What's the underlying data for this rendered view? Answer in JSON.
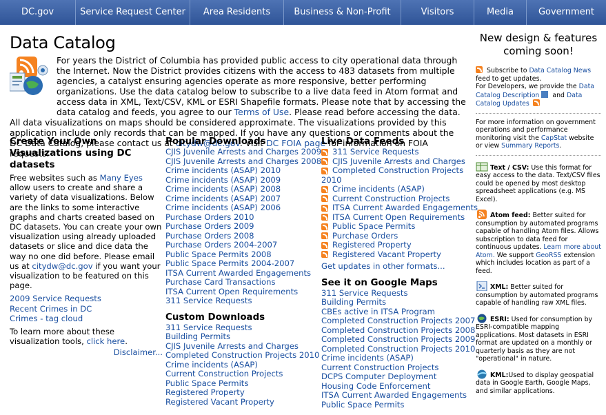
{
  "nav": [
    "DC.gov",
    "Service Request Center",
    "Area Residents",
    "Business & Non-Profit",
    "Visitors",
    "Media",
    "Government"
  ],
  "title": "Data Catalog",
  "intro": {
    "t1": "For years the District of Columbia has provided public access to city operational data through the Internet. Now the District provides citizens with the access to 483 datasets from multiple agencies, a catalyst ensuring agencies operate as more responsive, better performing organizations. Use the data catalog below to subscribe to a live data feed in Atom format and access data in XML, Text/CSV, KML or ESRI Shapefile formats. Please note that by accessing the data catalog and feeds, you agree to our ",
    "terms": "Terms of Use",
    "t2": ". Please read before accessing the data. All data visualizations on maps should be considered approximate. The visualizations provided by this application include only records that can be mapped. If you have any questions or comments about the DC Data Catalog, please contact us at ",
    "email": "citydw@dc.gov",
    "t3": ". Visit ",
    "foia": "DC FOIA page",
    "t4": " for information on FOIA requests."
  },
  "col1": {
    "heading": "Create Your Own Visualizations using DC datasets",
    "p1a": "Free websites such as ",
    "manyeyes": "Many Eyes",
    "p1b": " allow users to create and share a variety of data visualizations. Below are the links to some interactive graphs and charts created based on DC datasets. You can create your own visualization using already uploaded datasets or slice and dice data the way no one did before. Please email us at ",
    "email": "citydw@dc.gov",
    "p1c": " if you want your visualization to be featured on this page.",
    "links": [
      "2009 Service Requests",
      "Recent Crimes in DC",
      "Crimes - tag cloud"
    ],
    "p2a": "To learn more about these visualization tools, ",
    "clickhere": "click here",
    "p2b": ".",
    "disclaimer": "Disclaimer..."
  },
  "popular": {
    "heading": "Popular Downloads",
    "items": [
      "CJIS Juvenile Arrests and Charges 2009",
      "CJIS Juvenile Arrests and Charges 2008",
      "Crime incidents (ASAP) 2010",
      "Crime incidents (ASAP) 2009",
      "Crime incidents (ASAP) 2008",
      "Crime incidents (ASAP) 2007",
      "Crime incidents (ASAP) 2006",
      "Purchase Orders 2010",
      "Purchase Orders 2009",
      "Purchase Orders 2008",
      "Purchase Orders 2004-2007",
      "Public Space Permits 2008",
      "Public Space Permits 2004-2007",
      "ITSA Current Awarded Engagements",
      "Purchase Card Transactions",
      "ITSA Current Open Requirements",
      "311 Service Requests"
    ]
  },
  "custom": {
    "heading": "Custom Downloads",
    "items": [
      "311 Service Requests",
      "Building Permits",
      "CJIS Juvenile Arrests and Charges",
      "Completed Construction Projects 2010",
      "Crime incidents (ASAP)",
      "Current Construction Projects",
      "Public Space Permits",
      "Registered Property",
      "Registered Vacant Property"
    ]
  },
  "live": {
    "heading": "Live Data Feeds",
    "items": [
      "311 Service Requests",
      "CJIS Juvenile Arrests and Charges",
      "Completed Construction Projects",
      "Crime incidents (ASAP)",
      "Current Construction Projects",
      "ITSA Current Awarded Engagements",
      "ITSA Current Open Requirements",
      "Public Space Permits",
      "Purchase Orders",
      "Registered Property",
      "Registered Vacant Property"
    ],
    "wrap_tail": "2010",
    "more": "Get updates in other formats..."
  },
  "maps": {
    "heading": "See it on Google Maps",
    "items": [
      "311 Service Requests",
      "Building Permits",
      "CBEs active in ITSA Program",
      "Completed Construction Projects 2007",
      "Completed Construction Projects 2008",
      "Completed Construction Projects 2009",
      "Completed Construction Projects 2010",
      "Crime incidents (ASAP)",
      "Current Construction Projects",
      "DCPS Computer Deployment",
      "Housing Code Enforcement",
      "ITSA Current Awarded Engagements",
      "Public Space Permits"
    ]
  },
  "sidebar": {
    "new_head": "New design & features coming soon!",
    "sub1": "Subscribe to ",
    "news": "Data Catalog News",
    "sub2": " feed to get updates.",
    "dev1": "For Developers, we provide the ",
    "desc": "Data Catalog Description",
    "dev2": " and ",
    "updates": "Data Catalog Updates",
    "info1": "For more information on government operations and performance monitoring visit the ",
    "capstat": "CapStat",
    "info2": " website or view ",
    "summary": "Summary Reports",
    "info3": ".",
    "text_label": "Text / CSV:",
    "text_desc": " Use this format for easy access to the data. Text/CSV files could be opened by most desktop spreadsheet applications (e.g. MS Excel).",
    "atom_label": "Atom feed:",
    "atom_desc1": " Better suited for consumption by automated programs capable of handling Atom files. Allows subscription to data feed for continuous updates. ",
    "atom_link": "Learn more about Atom.",
    "atom_desc2": " We support ",
    "georss": "GeoRSS",
    "atom_desc3": " extension which includes location as part of a feed.",
    "xml_label": "XML:",
    "xml_desc": " Better suited for consumption by automated programs capable of handling raw XML files.",
    "esri_label": "ESRI:",
    "esri_desc": " Used for consumption by ESRI-compatible mapping applications. Most datasets in ESRI format are updated on a monthly or quarterly basis as they are not \"operational\" in nature.",
    "kml_label": "KML:",
    "kml_desc": "Used to display geospatial data in Google Earth, Google Maps, and similar applications."
  },
  "colors": {
    "nav": "#3a5fa3",
    "link": "#1a4fa0",
    "rss": "#f58220"
  }
}
